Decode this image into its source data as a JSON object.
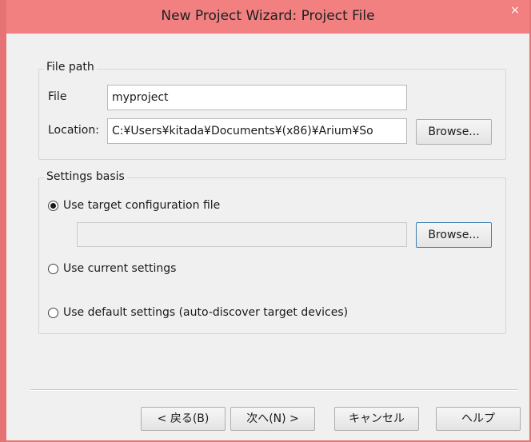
{
  "window": {
    "title": "New Project Wizard: Project File",
    "close_glyph": "×"
  },
  "file_path": {
    "legend": "File path",
    "file_label": "File",
    "file_value": "myproject",
    "location_label": "Location:",
    "location_value": "C:¥Users¥kitada¥Documents¥(x86)¥Arium¥So",
    "browse_label": "Browse..."
  },
  "settings_basis": {
    "legend": "Settings basis",
    "options": [
      {
        "label": "Use target configuration file",
        "checked": true
      },
      {
        "label": "Use current settings",
        "checked": false
      },
      {
        "label": "Use default settings (auto-discover target devices)",
        "checked": false
      }
    ],
    "config_file_value": "",
    "browse_label": "Browse..."
  },
  "footer": {
    "back_label": "< 戻る(B)",
    "next_label": "次へ(N) >",
    "cancel_label": "キャンセル",
    "help_label": "ヘルプ"
  }
}
